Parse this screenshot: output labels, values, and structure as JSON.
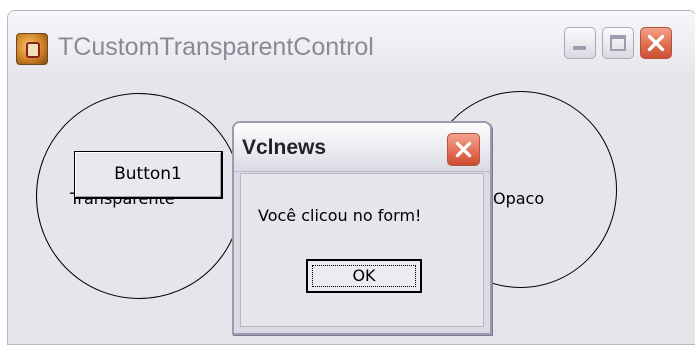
{
  "window": {
    "title": "TCustomTransparentControl",
    "icon": "delphi-app-icon",
    "controls": {
      "minimize": "minimize-icon",
      "maximize": "maximize-icon",
      "close": "close-icon"
    }
  },
  "form": {
    "button1_label": "Button1",
    "left_shape_label": "Transparente",
    "right_shape_label": "Opaco"
  },
  "dialog": {
    "title": "Vclnews",
    "message": "Você clicou no form!",
    "ok_label": "OK"
  },
  "colors": {
    "window_bg": "#e6e5ea",
    "close_button": "#e06f51"
  }
}
